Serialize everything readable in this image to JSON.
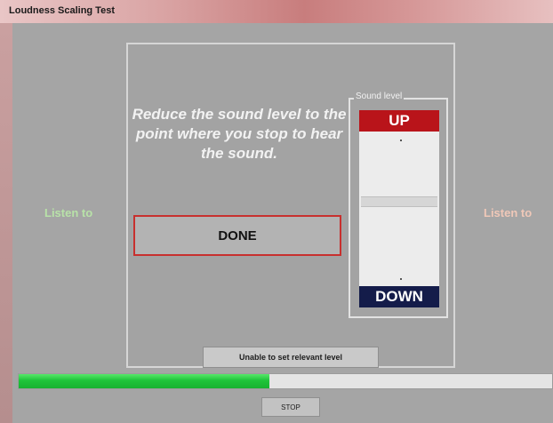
{
  "window": {
    "title": "Loudness Scaling Test"
  },
  "main": {
    "instruction": "Reduce the sound level to the point where you stop to hear the sound.",
    "listen_left": "Listen to",
    "listen_right": "Listen to",
    "done_label": "DONE"
  },
  "sound_level": {
    "legend": "Sound level",
    "up_label": "UP",
    "down_label": "DOWN",
    "level_fraction": 0.45
  },
  "unable_label": "Unable to set relevant level",
  "progress": {
    "fraction": 0.47
  },
  "stop_label": "STOP",
  "colors": {
    "up": "#b9141a",
    "down": "#141c4a",
    "done_border": "#c8302e",
    "progress": "#1fc43a"
  }
}
